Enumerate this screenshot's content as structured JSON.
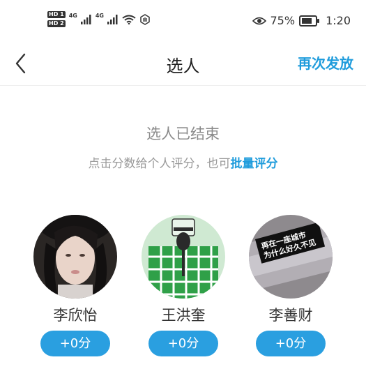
{
  "status_bar": {
    "sim1": "HD 1",
    "sim2": "HD 2",
    "net1": "4G",
    "net2": "4G",
    "battery_text": "75%",
    "battery_level": 0.75,
    "time": "1:20",
    "icons": [
      "signal-icon",
      "wifi-icon",
      "eye-icon",
      "battery-icon"
    ]
  },
  "nav": {
    "back_icon": "chevron-left-icon",
    "title": "选人",
    "resend_label": "再次发放"
  },
  "notice": {
    "title": "选人已结束",
    "subtitle_prefix": "点击分数给个人评分，也可",
    "subtitle_link": "批量评分"
  },
  "people": [
    {
      "name": "李欣怡",
      "score_label": "+0分"
    },
    {
      "name": "王洪奎",
      "score_label": "+0分"
    },
    {
      "name": "李善财",
      "score_label": "+0分",
      "avatar_text_line1": "再在一座城市",
      "avatar_text_line2": "为什么好久不见"
    }
  ],
  "colors": {
    "accent": "#1f9cdc",
    "score_button": "#2a9fe0",
    "avatar2_green": "#2fa048"
  }
}
